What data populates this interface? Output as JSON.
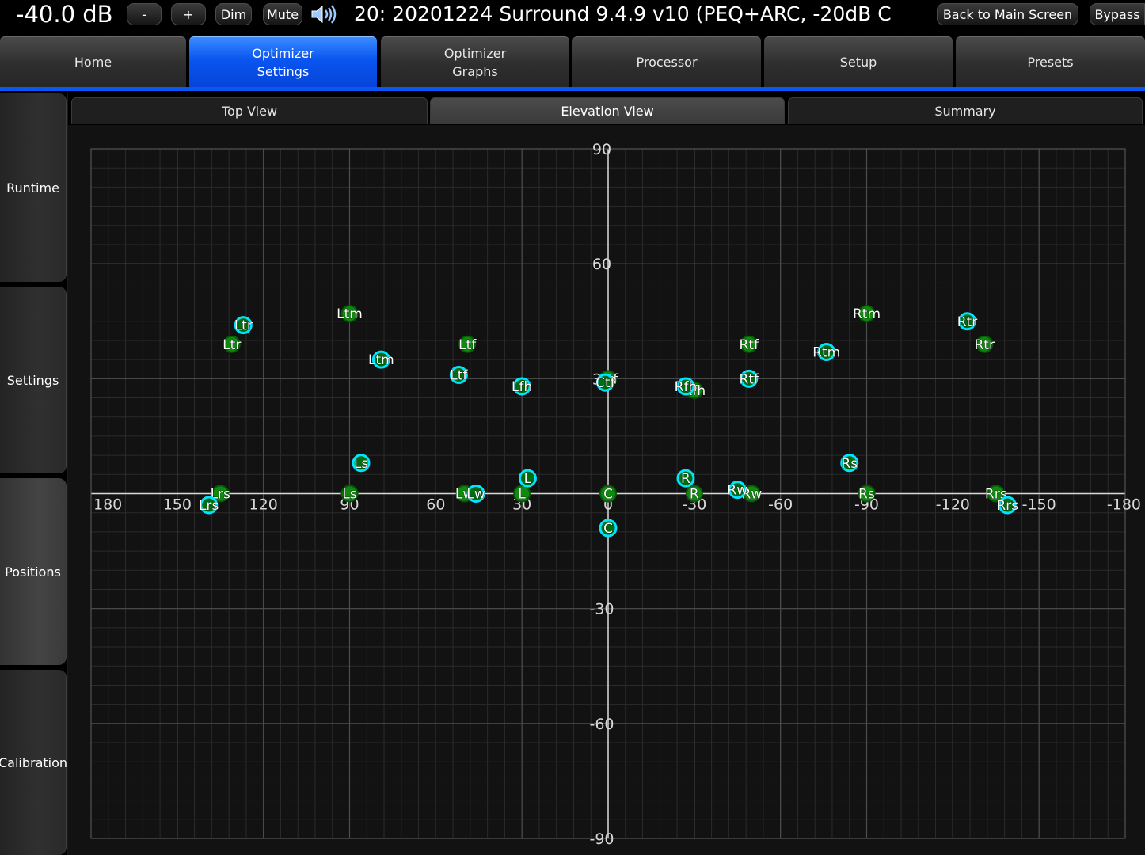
{
  "topbar": {
    "volume": "-40.0 dB",
    "minus_label": "-",
    "plus_label": "+",
    "dim_label": "Dim",
    "mute_label": "Mute",
    "preset_title": "20: 20201224 Surround 9.4.9 v10 (PEQ+ARC, -20dB C",
    "back_label": "Back to Main Screen",
    "bypass_label": "Bypass"
  },
  "nav": {
    "home": "Home",
    "optimizer_settings_1": "Optimizer",
    "optimizer_settings_2": "Settings",
    "optimizer_graphs_1": "Optimizer",
    "optimizer_graphs_2": "Graphs",
    "processor": "Processor",
    "setup": "Setup",
    "presets": "Presets",
    "active": "Optimizer Settings"
  },
  "sidenav": {
    "runtime": "Runtime",
    "settings": "Settings",
    "positions": "Positions",
    "calibration": "Calibration",
    "active": "Positions"
  },
  "subtabs": {
    "top_view": "Top View",
    "elevation_view": "Elevation View",
    "summary": "Summary",
    "active": "Elevation View"
  },
  "colors": {
    "nav_active": "#0b57f5",
    "marker_green": "#0f8a0f",
    "marker_cyan": "#00e5ff"
  },
  "chart_data": {
    "type": "scatter",
    "xlabel": "",
    "ylabel": "",
    "xlim": [
      180,
      -180
    ],
    "ylim": [
      -90,
      90
    ],
    "xticks": [
      180,
      150,
      120,
      90,
      60,
      30,
      0,
      -30,
      -60,
      -90,
      -120,
      -150,
      -180
    ],
    "xtick_labels": [
      "180",
      "150",
      "120",
      "90",
      "60",
      "30",
      "0",
      "-30",
      "-60",
      "-90",
      "-120",
      "-150",
      "-180"
    ],
    "yticks": [
      90,
      60,
      30,
      -30,
      -60,
      -90
    ],
    "ytick_labels": [
      "90",
      "60",
      "30",
      "-30",
      "-60",
      "-90"
    ],
    "grid": true,
    "series": [
      {
        "color": "#0f8a0f",
        "points": [
          {
            "label": "Ltr",
            "x": 131,
            "y": 39
          },
          {
            "label": "Ltm",
            "x": 90,
            "y": 47
          },
          {
            "label": "Ltf",
            "x": 49,
            "y": 39
          },
          {
            "label": "Lfh",
            "x": 30,
            "y": 28
          },
          {
            "label": "Ctf",
            "x": 0,
            "y": 30
          },
          {
            "label": "Rfh",
            "x": -30,
            "y": 27
          },
          {
            "label": "Rtf",
            "x": -49,
            "y": 39
          },
          {
            "label": "Rtm",
            "x": -90,
            "y": 47
          },
          {
            "label": "Rtr",
            "x": -131,
            "y": 39
          },
          {
            "label": "Lrs",
            "x": 135,
            "y": 0
          },
          {
            "label": "Ls",
            "x": 90,
            "y": 0
          },
          {
            "label": "Lw",
            "x": 50,
            "y": 0
          },
          {
            "label": "L",
            "x": 30,
            "y": 0
          },
          {
            "label": "C",
            "x": 0,
            "y": 0
          },
          {
            "label": "R",
            "x": -30,
            "y": 0
          },
          {
            "label": "Rw",
            "x": -50,
            "y": 0
          },
          {
            "label": "Rs",
            "x": -90,
            "y": 0
          },
          {
            "label": "Rrs",
            "x": -135,
            "y": 0
          }
        ]
      },
      {
        "color": "#00e5ff",
        "points": [
          {
            "label": "Ltr",
            "x": 127,
            "y": 44
          },
          {
            "label": "Ltm",
            "x": 79,
            "y": 35
          },
          {
            "label": "Ltf",
            "x": 52,
            "y": 31
          },
          {
            "label": "Lfh",
            "x": 30,
            "y": 28
          },
          {
            "label": "Ctf",
            "x": 1,
            "y": 29
          },
          {
            "label": "Rfh",
            "x": -27,
            "y": 28
          },
          {
            "label": "Rtf",
            "x": -49,
            "y": 30
          },
          {
            "label": "Rtm",
            "x": -76,
            "y": 37
          },
          {
            "label": "Rtr",
            "x": -125,
            "y": 45
          },
          {
            "label": "Lrs",
            "x": 139,
            "y": -3
          },
          {
            "label": "Ls",
            "x": 86,
            "y": 8
          },
          {
            "label": "Lw",
            "x": 46,
            "y": 0
          },
          {
            "label": "L",
            "x": 28,
            "y": 4
          },
          {
            "label": "C",
            "x": 0,
            "y": -9
          },
          {
            "label": "R",
            "x": -27,
            "y": 4
          },
          {
            "label": "Rw",
            "x": -45,
            "y": 1
          },
          {
            "label": "Rs",
            "x": -84,
            "y": 8
          },
          {
            "label": "Rrs",
            "x": -139,
            "y": -3
          }
        ]
      }
    ]
  }
}
